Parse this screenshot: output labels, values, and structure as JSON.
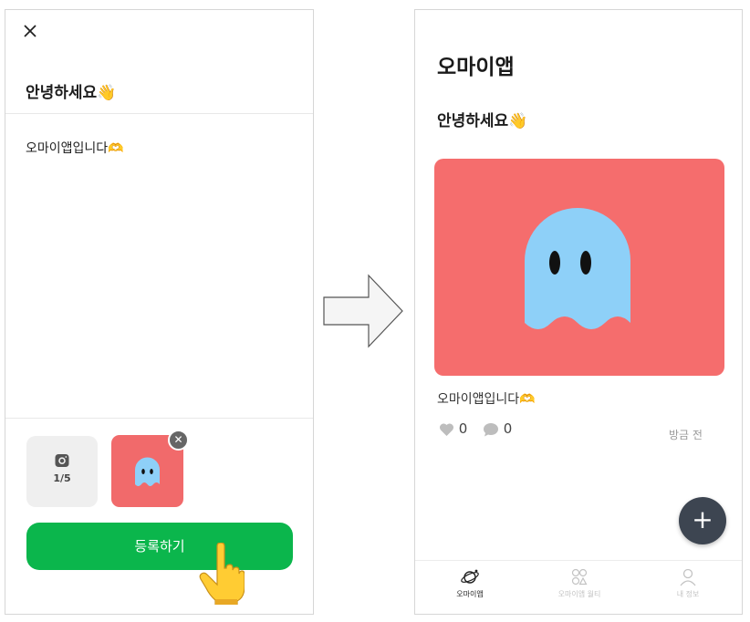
{
  "left_screen": {
    "close_icon": "close-icon",
    "title": "안녕하세요👋",
    "body_text": "오마이앱입니다🫶",
    "photo_counter": "1/5",
    "camera_icon": "camera-icon",
    "remove_icon": "remove-icon",
    "submit_label": "등록하기",
    "submit_color": "#0bb64c",
    "thumbnail_bg": "#f16a6b"
  },
  "flow_arrow": "arrow-right-icon",
  "right_screen": {
    "app_title": "오마이앱",
    "post_title": "안녕하세요👋",
    "post_body": "오마이앱입니다🫶",
    "likes": "0",
    "comments": "0",
    "timestamp": "방금 전",
    "fab_label": "+",
    "tabs": [
      {
        "label": "오마이앱",
        "icon": "planet-icon",
        "active": true
      },
      {
        "label": "오마이앱 월티",
        "icon": "grid-circles-icon",
        "active": false
      },
      {
        "label": "내 정보",
        "icon": "person-icon",
        "active": false
      }
    ]
  },
  "colors": {
    "ghost": "#8ed0f8",
    "image_bg": "#f56d6d",
    "fab": "#3d4551"
  }
}
